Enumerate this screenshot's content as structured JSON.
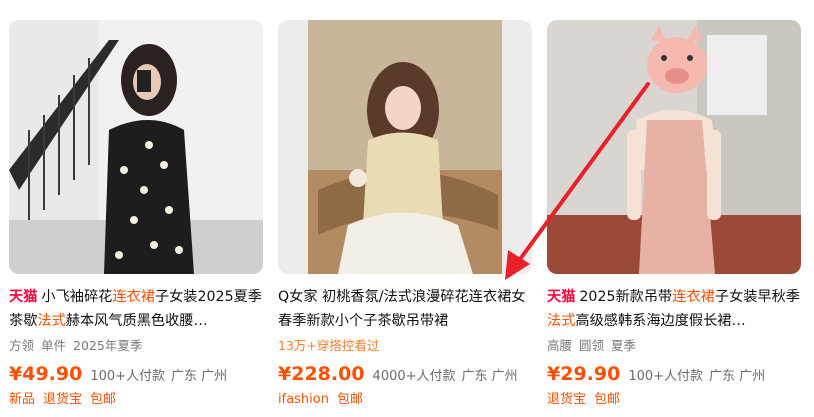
{
  "products": [
    {
      "tmall": "天猫",
      "title_pre": "小飞袖碎花",
      "title_hl1": "连衣裙",
      "title_mid": "子女装2025夏季茶歇",
      "title_hl2": "法式",
      "title_post": "赫本风气质黑色收腰…",
      "tags": [
        "方领",
        "单件",
        "2025年夏季"
      ],
      "price": "¥49.90",
      "sold": "100+人付款",
      "location": "广东 广州",
      "badges": [
        "新品",
        "退货宝",
        "包邮"
      ]
    },
    {
      "title_pre": "Q女家 初桃香氛/法式浪漫碎花连衣裙女春季新款小个子茶歇吊带裙",
      "tags": [
        "13万+穿搭控看过"
      ],
      "price": "¥228.00",
      "sold": "4000+人付款",
      "location": "广东 广州",
      "badges": [
        "ifashion",
        "包邮"
      ]
    },
    {
      "tmall": "天猫",
      "title_pre": "2025新款吊带",
      "title_hl1": "连衣裙",
      "title_mid": "子女装早秋季",
      "title_hl2": "法式",
      "title_post": "高级感韩系海边度假长裙…",
      "tags": [
        "高腰",
        "圆领",
        "夏季"
      ],
      "price": "¥29.90",
      "sold": "100+人付款",
      "location": "广东 广州",
      "badges": [
        "退货宝",
        "包邮"
      ]
    }
  ],
  "colors": {
    "tmall": "#ff0036",
    "accent": "#ff5000",
    "arrow": "#e8202a"
  }
}
